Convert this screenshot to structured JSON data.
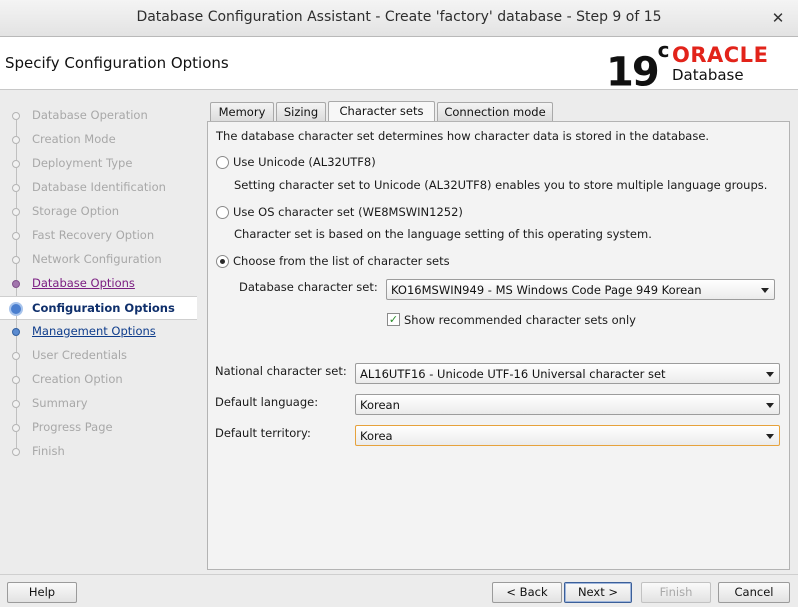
{
  "window": {
    "title": "Database Configuration Assistant - Create 'factory' database - Step 9 of 15",
    "close_glyph": "✕"
  },
  "header": {
    "page_title": "Specify Configuration Options",
    "logo": {
      "version": "19",
      "version_suffix": "c",
      "brand": "ORACLE",
      "product": "Database"
    }
  },
  "sidebar": {
    "steps": [
      {
        "label": "Database Operation",
        "state": "disabled"
      },
      {
        "label": "Creation Mode",
        "state": "disabled"
      },
      {
        "label": "Deployment Type",
        "state": "disabled"
      },
      {
        "label": "Database Identification",
        "state": "disabled"
      },
      {
        "label": "Storage Option",
        "state": "disabled"
      },
      {
        "label": "Fast Recovery Option",
        "state": "disabled"
      },
      {
        "label": "Network Configuration",
        "state": "disabled"
      },
      {
        "label": "Database Options",
        "state": "visited"
      },
      {
        "label": "Configuration Options",
        "state": "current"
      },
      {
        "label": "Management Options",
        "state": "link"
      },
      {
        "label": "User Credentials",
        "state": "disabled"
      },
      {
        "label": "Creation Option",
        "state": "disabled"
      },
      {
        "label": "Summary",
        "state": "disabled"
      },
      {
        "label": "Progress Page",
        "state": "disabled"
      },
      {
        "label": "Finish",
        "state": "disabled"
      }
    ]
  },
  "tabs": {
    "memory": "Memory",
    "sizing": "Sizing",
    "charsets": "Character sets",
    "connection": "Connection mode",
    "active": "Character sets"
  },
  "charset": {
    "intro": "The database character set determines how character data is stored in the database.",
    "unicode_label": "Use Unicode (AL32UTF8)",
    "unicode_desc": "Setting character set to Unicode (AL32UTF8) enables you to store multiple language groups.",
    "os_label": "Use OS character set (WE8MSWIN1252)",
    "os_desc": "Character set is based on the language setting of this operating system.",
    "list_label": "Choose from the list of character sets",
    "selected_option": "Choose from the list of character sets",
    "db_charset_label": "Database character set:",
    "db_charset_value": "KO16MSWIN949 - MS Windows Code Page 949 Korean",
    "show_recommended_label": "Show recommended character sets only",
    "show_recommended_checked": true,
    "national_label": "National character set:",
    "national_value": "AL16UTF16 - Unicode UTF-16 Universal character set",
    "language_label": "Default language:",
    "language_value": "Korean",
    "territory_label": "Default territory:",
    "territory_value": "Korea"
  },
  "buttons": {
    "help": "Help",
    "back": "< Back",
    "next": "Next >",
    "finish": "Finish",
    "cancel": "Cancel"
  }
}
